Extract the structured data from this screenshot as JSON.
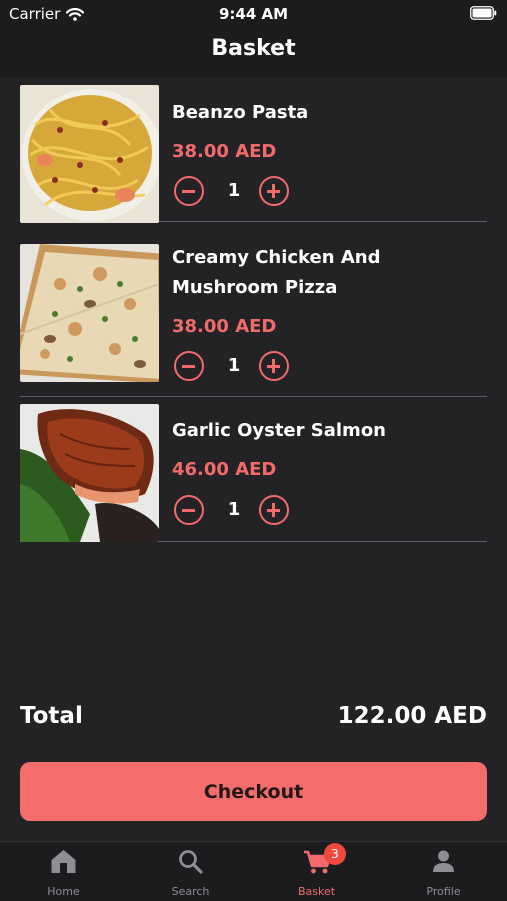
{
  "status_bar": {
    "carrier": "Carrier",
    "time": "9:44 AM"
  },
  "header": {
    "title": "Basket"
  },
  "items": [
    {
      "name": "Beanzo Pasta",
      "price": "38.00 AED",
      "quantity": "1",
      "image": "pasta-photo"
    },
    {
      "name": "Creamy Chicken And Mushroom Pizza",
      "price": "38.00 AED",
      "quantity": "1",
      "image": "pizza-photo"
    },
    {
      "name": "Garlic Oyster Salmon",
      "price": "46.00 AED",
      "quantity": "1",
      "image": "salmon-photo"
    }
  ],
  "summary": {
    "total_label": "Total",
    "total_value": "122.00 AED"
  },
  "checkout": {
    "label": "Checkout"
  },
  "tabs": [
    {
      "label": "Home",
      "icon": "home-icon"
    },
    {
      "label": "Search",
      "icon": "search-icon"
    },
    {
      "label": "Basket",
      "icon": "cart-icon",
      "active": true,
      "badge": "3"
    },
    {
      "label": "Profile",
      "icon": "person-icon"
    }
  ],
  "colors": {
    "accent": "#f26b6b",
    "background": "#232326",
    "bar": "#1c1c1e",
    "badge": "#f04a3e"
  }
}
